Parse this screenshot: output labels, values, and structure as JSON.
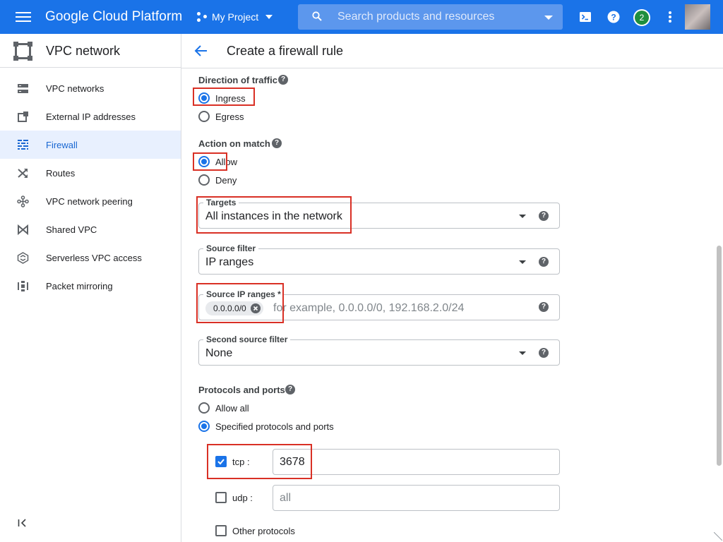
{
  "topbar": {
    "brand": "Google Cloud Platform",
    "project": "My Project",
    "search_placeholder": "Search products and resources",
    "notification_count": "2",
    "colors": {
      "bar": "#1a73e8",
      "badge": "#1e8e3e"
    }
  },
  "sidebar": {
    "title": "VPC network",
    "items": [
      {
        "label": "VPC networks",
        "icon": "vpc-networks-icon"
      },
      {
        "label": "External IP addresses",
        "icon": "external-ip-icon"
      },
      {
        "label": "Firewall",
        "icon": "firewall-icon",
        "active": true
      },
      {
        "label": "Routes",
        "icon": "routes-icon"
      },
      {
        "label": "VPC network peering",
        "icon": "peering-icon"
      },
      {
        "label": "Shared VPC",
        "icon": "shared-vpc-icon"
      },
      {
        "label": "Serverless VPC access",
        "icon": "serverless-icon"
      },
      {
        "label": "Packet mirroring",
        "icon": "packet-mirroring-icon"
      }
    ]
  },
  "main": {
    "page_title": "Create a firewall rule",
    "direction": {
      "label": "Direction of traffic",
      "options": [
        "Ingress",
        "Egress"
      ],
      "selected": "Ingress"
    },
    "action": {
      "label": "Action on match",
      "options": [
        "Allow",
        "Deny"
      ],
      "selected": "Allow"
    },
    "targets": {
      "label": "Targets",
      "value": "All instances in the network"
    },
    "source_filter": {
      "label": "Source filter",
      "value": "IP ranges"
    },
    "source_ip": {
      "label": "Source IP ranges *",
      "chip": "0.0.0.0/0",
      "placeholder": "for example, 0.0.0.0/0, 192.168.2.0/24"
    },
    "second_source_filter": {
      "label": "Second source filter",
      "value": "None"
    },
    "protocols": {
      "label": "Protocols and ports",
      "options": [
        "Allow all",
        "Specified protocols and ports"
      ],
      "selected": "Specified protocols and ports",
      "tcp": {
        "label": "tcp :",
        "checked": true,
        "value": "3678"
      },
      "udp": {
        "label": "udp :",
        "checked": false,
        "placeholder": "all"
      },
      "other": {
        "label": "Other protocols",
        "checked": false
      }
    },
    "highlight_color": "#d93025"
  }
}
